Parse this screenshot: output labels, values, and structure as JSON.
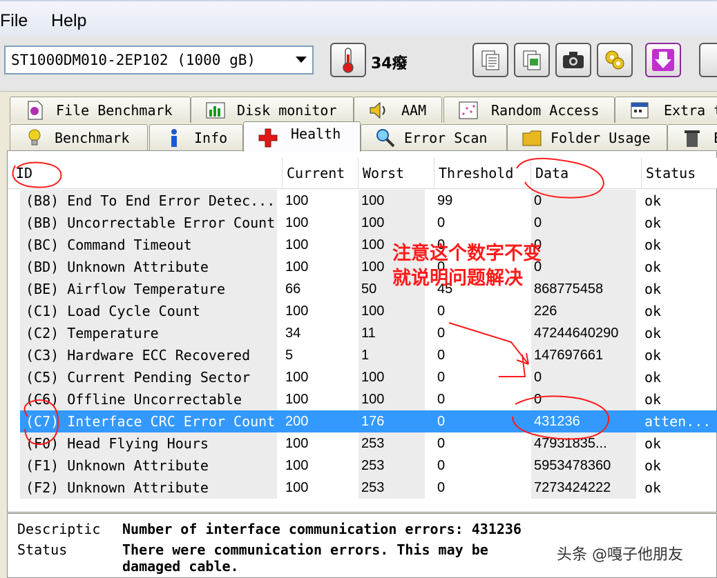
{
  "menu": {
    "file": "File",
    "help": "Help"
  },
  "toolbar": {
    "drive": "ST1000DM010-2EP102 (1000 gB)",
    "temperature": "34癈",
    "buttons": [
      "copy-text-icon",
      "copy-image-icon",
      "camera-icon",
      "options-icon",
      "save-down-icon"
    ]
  },
  "tabs_top": [
    {
      "label": "File Benchmark",
      "icon": "file-benchmark-icon"
    },
    {
      "label": "Disk monitor",
      "icon": "disk-monitor-icon"
    },
    {
      "label": "AAM",
      "icon": "speaker-icon"
    },
    {
      "label": "Random Access",
      "icon": "random-access-icon"
    },
    {
      "label": "Extra t",
      "icon": "extra-tests-icon"
    }
  ],
  "tabs_bottom": [
    {
      "label": "Benchmark",
      "icon": "bulb-icon"
    },
    {
      "label": "Info",
      "icon": "info-icon"
    },
    {
      "label": "Health",
      "icon": "health-cross-icon",
      "active": true
    },
    {
      "label": "Error Scan",
      "icon": "magnifier-icon"
    },
    {
      "label": "Folder Usage",
      "icon": "folder-icon"
    },
    {
      "label": "E",
      "icon": "trash-icon"
    }
  ],
  "table": {
    "columns": [
      "ID",
      "Current",
      "Worst",
      "Threshold",
      "Data",
      "Status"
    ],
    "rows": [
      [
        "(B8) End To End Error Detec...",
        "100",
        "100",
        "99",
        "0",
        "ok"
      ],
      [
        "(BB) Uncorrectable Error Count",
        "100",
        "100",
        "0",
        "0",
        "ok"
      ],
      [
        "(BC) Command Timeout",
        "100",
        "100",
        "0",
        "0",
        "ok"
      ],
      [
        "(BD) Unknown Attribute",
        "100",
        "100",
        "0",
        "0",
        "ok"
      ],
      [
        "(BE) Airflow Temperature",
        "66",
        "50",
        "45",
        "868775458",
        "ok"
      ],
      [
        "(C1) Load Cycle Count",
        "100",
        "100",
        "0",
        "226",
        "ok"
      ],
      [
        "(C2) Temperature",
        "34",
        "11",
        "0",
        "47244640290",
        "ok"
      ],
      [
        "(C3) Hardware ECC Recovered",
        "5",
        "1",
        "0",
        "147697661",
        "ok"
      ],
      [
        "(C5) Current Pending Sector",
        "100",
        "100",
        "0",
        "0",
        "ok"
      ],
      [
        "(C6) Offline Uncorrectable",
        "100",
        "100",
        "0",
        "0",
        "ok"
      ],
      [
        "(C7) Interface CRC Error Count",
        "200",
        "176",
        "0",
        "431236",
        "atten..."
      ],
      [
        "(F0) Head Flying Hours",
        "100",
        "253",
        "0",
        "47931835...",
        "ok"
      ],
      [
        "(F1) Unknown Attribute",
        "100",
        "253",
        "0",
        "5953478360",
        "ok"
      ],
      [
        "(F2) Unknown Attribute",
        "100",
        "253",
        "0",
        "7273424222",
        "ok"
      ]
    ],
    "selected_row": 10
  },
  "description": {
    "label": "Descriptic",
    "text": "Number of interface communication errors: 431236",
    "status_label": "Status",
    "status_line1": "There were communication errors. This may be",
    "status_line2": "damaged cable."
  },
  "annotation": {
    "note": "注意这个数字不变就说明问题解决",
    "color": "#ff1a1a"
  },
  "watermark": "头条 @嘎子他朋友",
  "colors": {
    "selection": "#3399ff",
    "annotation": "#ff1a1a"
  }
}
